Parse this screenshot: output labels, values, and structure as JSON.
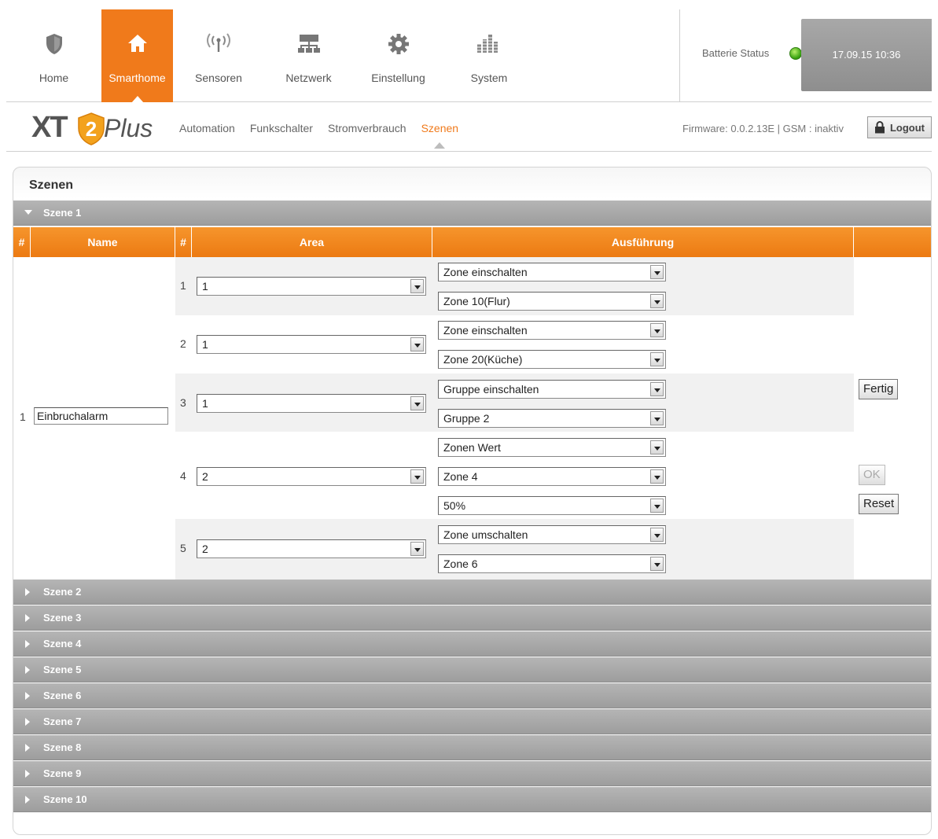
{
  "nav": {
    "items": [
      {
        "label": "Home",
        "icon": "shield-icon"
      },
      {
        "label": "Smarthome",
        "icon": "house-icon"
      },
      {
        "label": "Sensoren",
        "icon": "antenna-icon"
      },
      {
        "label": "Netzwerk",
        "icon": "network-icon"
      },
      {
        "label": "Einstellung",
        "icon": "gear-icon"
      },
      {
        "label": "System",
        "icon": "bars-icon"
      }
    ],
    "active": "Smarthome"
  },
  "battery": {
    "label": "Batterie Status",
    "status_color": "#3aa311"
  },
  "datetime": "17.09.15 10:36",
  "logo": {
    "xt": "XT",
    "two": "2",
    "plus": "Plus"
  },
  "subnav": [
    "Automation",
    "Funkschalter",
    "Stromverbrauch",
    "Szenen"
  ],
  "firmware": "Firmware: 0.0.2.13E | GSM : inaktiv",
  "logout_label": "Logout",
  "page_title": "Szenen",
  "colors": {
    "accent": "#f07a1b",
    "accordion": "#a8a8a8"
  },
  "scenes": [
    "Szene 1",
    "Szene 2",
    "Szene 3",
    "Szene 4",
    "Szene 5",
    "Szene 6",
    "Szene 7",
    "Szene 8",
    "Szene 9",
    "Szene 10"
  ],
  "table": {
    "headers": {
      "num": "#",
      "name": "Name",
      "num2": "#",
      "area": "Area",
      "exec": "Ausführung"
    },
    "scene_row": "1",
    "scene_name": "Einbruchalarm",
    "actions": [
      {
        "num": "1",
        "area": "1",
        "exec": [
          "Zone einschalten",
          "Zone 10(Flur)"
        ]
      },
      {
        "num": "2",
        "area": "1",
        "exec": [
          "Zone einschalten",
          "Zone 20(Küche)"
        ]
      },
      {
        "num": "3",
        "area": "1",
        "exec": [
          "Gruppe einschalten",
          "Gruppe 2"
        ]
      },
      {
        "num": "4",
        "area": "2",
        "exec": [
          "Zonen Wert",
          "Zone 4",
          "50%"
        ]
      },
      {
        "num": "5",
        "area": "2",
        "exec": [
          "Zone umschalten",
          "Zone 6"
        ]
      }
    ]
  },
  "buttons": {
    "fertig": "Fertig",
    "ok": "OK",
    "reset": "Reset"
  }
}
